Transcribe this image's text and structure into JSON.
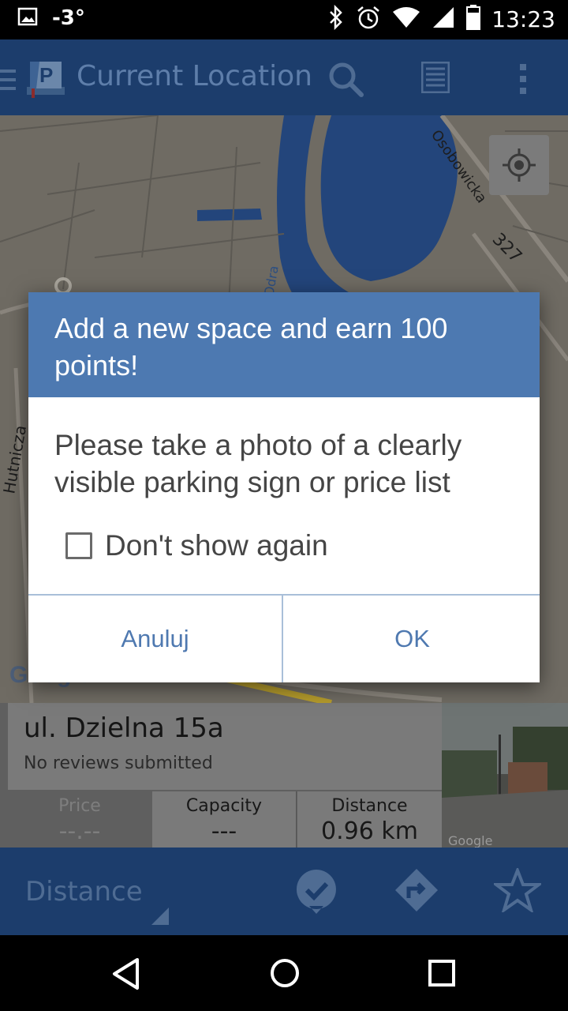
{
  "status_bar": {
    "temperature": "-3°",
    "time": "13:23",
    "icons": [
      "image-icon",
      "bluetooth-icon",
      "alarm-icon",
      "wifi-icon",
      "signal-icon",
      "battery-icon"
    ]
  },
  "app_bar": {
    "title": "Current Location",
    "icons": [
      "menu-icon",
      "app-logo-icon",
      "search-icon",
      "list-icon",
      "overflow-menu-icon"
    ]
  },
  "map": {
    "labels": {
      "street_osobowicka": "Osobowicka",
      "road_number": "327",
      "river": "Odra",
      "street_hutnicza": "Hutnicza"
    },
    "attribution": "Google"
  },
  "dialog": {
    "title": "Add a new space and earn 100 points!",
    "message": "Please take a photo of a clearly visible parking sign or price list",
    "checkbox_label": "Don't show again",
    "checkbox_checked": false,
    "cancel_label": "Anuluj",
    "ok_label": "OK",
    "colors": {
      "header": "#4d79b1",
      "button_text": "#4f79b0"
    }
  },
  "place_card": {
    "address": "ul. Dzielna 15a",
    "reviews": "No reviews submitted",
    "price_label": "Price",
    "price_value": "--.--",
    "capacity_label": "Capacity",
    "capacity_value": "---",
    "distance_label": "Distance",
    "distance_value": "0.96 km",
    "streetview_attribution": "Google"
  },
  "bottom_bar": {
    "sort_label": "Distance",
    "icons": [
      "check-badge-icon",
      "directions-icon",
      "star-icon"
    ]
  },
  "nav_bar": {
    "icons": [
      "back-icon",
      "home-icon",
      "recents-icon"
    ]
  }
}
